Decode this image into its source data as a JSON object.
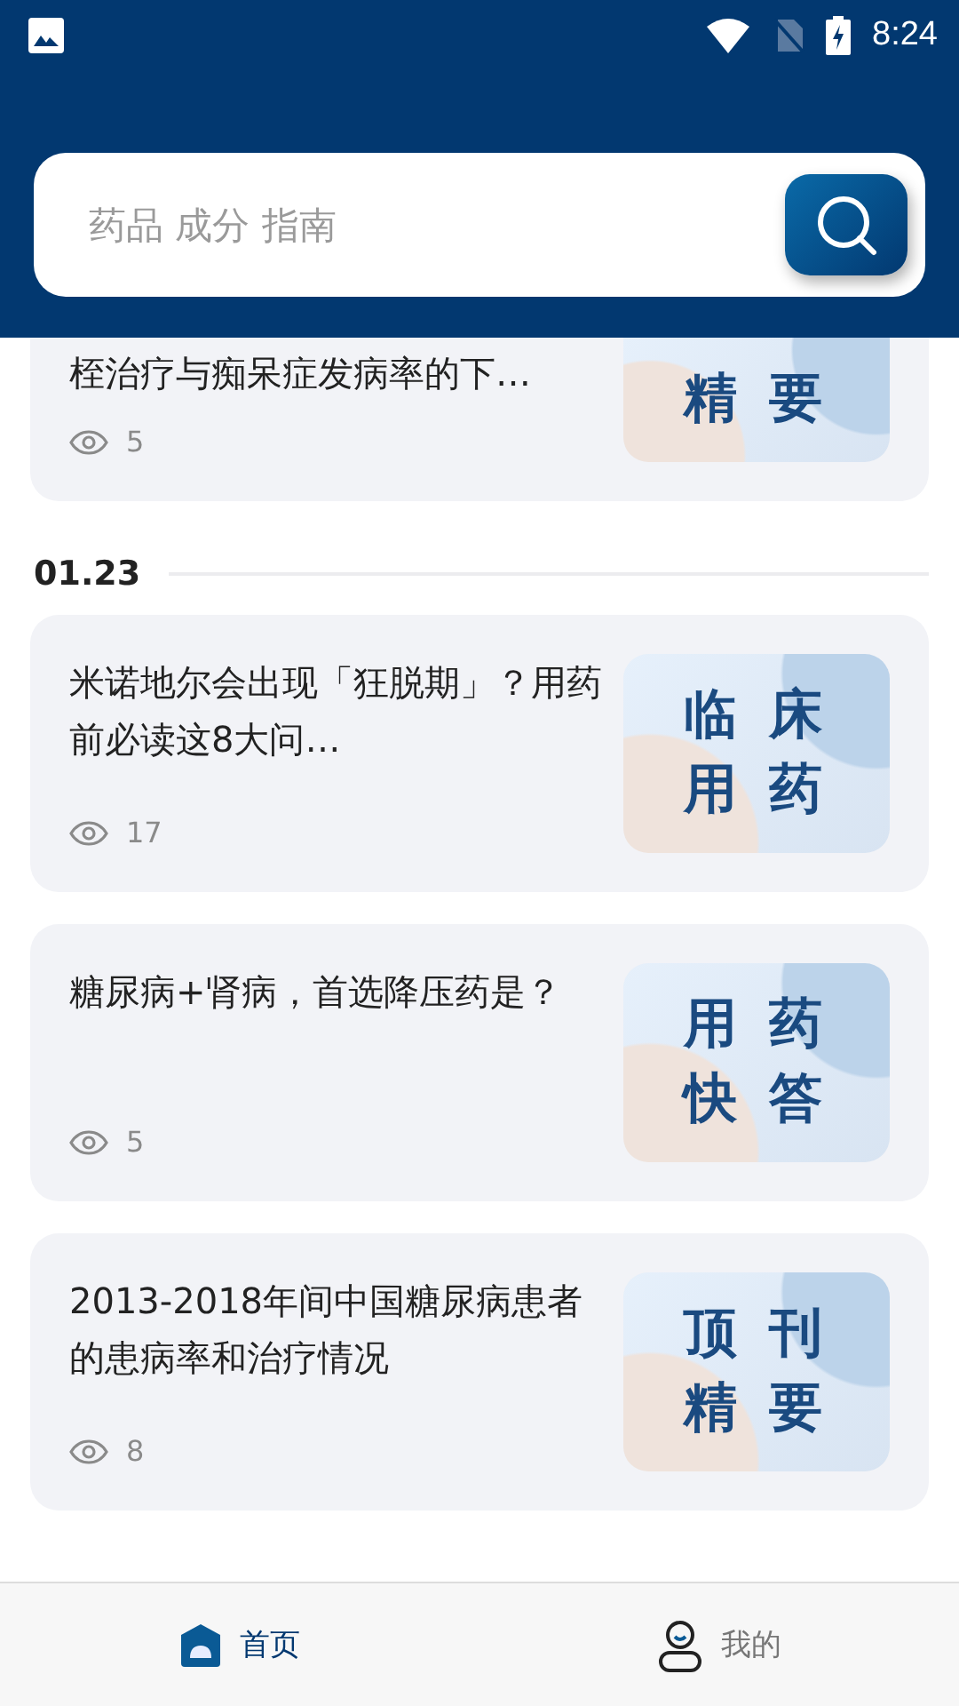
{
  "status_bar": {
    "time": "8:24"
  },
  "search": {
    "placeholder": "药品 成分 指南"
  },
  "articles_before": [
    {
      "title": "桎治疗与痴呆症发病率的下…",
      "views": "5",
      "cover": [
        "精 要"
      ]
    }
  ],
  "date_header": "01.23",
  "articles": [
    {
      "title": "米诺地尔会出现「狂脱期」？用药前必读这8大问…",
      "views": "17",
      "cover": [
        "临 床",
        "用 药"
      ]
    },
    {
      "title": "糖尿病+肾病，首选降压药是？",
      "views": "5",
      "cover": [
        "用 药",
        "快 答"
      ]
    },
    {
      "title": "2013-2018年间中国糖尿病患者的患病率和治疗情况",
      "views": "8",
      "cover": [
        "顶 刊",
        "精 要"
      ]
    }
  ],
  "bottom_nav": [
    {
      "label": "首页",
      "selected": true
    },
    {
      "label": "我的",
      "selected": false
    }
  ]
}
